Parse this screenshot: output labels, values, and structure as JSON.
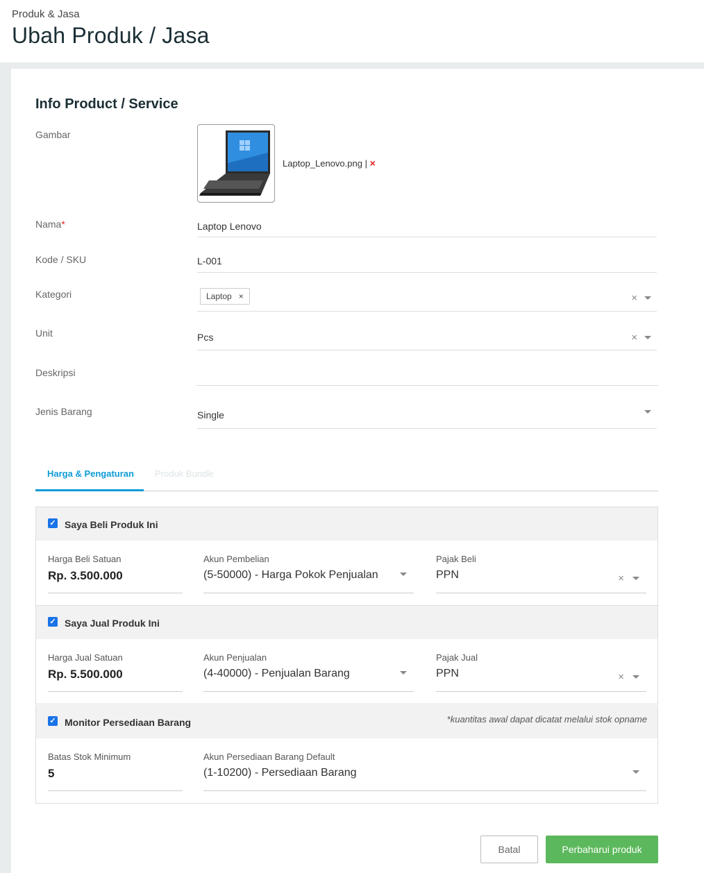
{
  "header": {
    "breadcrumb": "Produk & Jasa",
    "title": "Ubah Produk / Jasa"
  },
  "form": {
    "section_title": "Info Product / Service",
    "labels": {
      "gambar": "Gambar",
      "nama": "Nama",
      "required_mark": "*",
      "kode": "Kode / SKU",
      "kategori": "Kategori",
      "unit": "Unit",
      "deskripsi": "Deskripsi",
      "jenis": "Jenis Barang"
    },
    "image": {
      "filename": "Laptop_Lenovo.png",
      "separator": "|",
      "delete_icon": "×"
    },
    "values": {
      "nama": "Laptop Lenovo",
      "kode": "L-001",
      "kategori_chip": "Laptop",
      "unit": "Pcs",
      "deskripsi": "",
      "jenis": "Single"
    }
  },
  "tabs": [
    {
      "label": "Harga & Pengaturan",
      "active": true
    },
    {
      "label": "Produk Bundle",
      "active": false
    }
  ],
  "buy": {
    "checkbox_label": "Saya Beli Produk Ini",
    "checked": true,
    "price_label": "Harga Beli Satuan",
    "price_value": "Rp. 3.500.000",
    "account_label": "Akun Pembelian",
    "account_value": "(5-50000) - Harga Pokok Penjualan",
    "tax_label": "Pajak Beli",
    "tax_value": "PPN"
  },
  "sell": {
    "checkbox_label": "Saya Jual Produk Ini",
    "checked": true,
    "price_label": "Harga Jual Satuan",
    "price_value": "Rp. 5.500.000",
    "account_label": "Akun Penjualan",
    "account_value": "(4-40000) - Penjualan Barang",
    "tax_label": "Pajak Jual",
    "tax_value": "PPN"
  },
  "inventory": {
    "checkbox_label": "Monitor Persediaan Barang",
    "checked": true,
    "note": "*kuantitas awal dapat dicatat melalui stok opname",
    "min_label": "Batas Stok Minimum",
    "min_value": "5",
    "account_label": "Akun Persediaan Barang Default",
    "account_value": "(1-10200) - Persediaan Barang"
  },
  "actions": {
    "cancel": "Batal",
    "save": "Perbaharui produk"
  },
  "colors": {
    "accent": "#0d9bd6",
    "save_button": "#5cb85c",
    "delete": "#e02020",
    "checkbox": "#1a73e8"
  }
}
